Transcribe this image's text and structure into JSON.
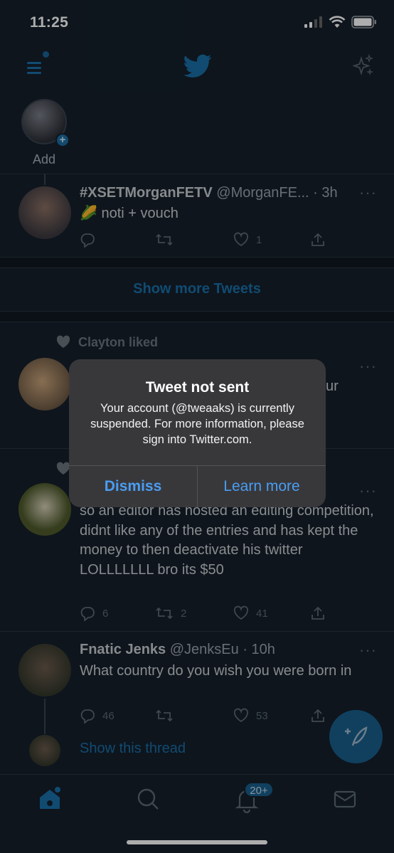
{
  "status_bar": {
    "time": "11:25"
  },
  "fleets": {
    "add_label": "Add"
  },
  "tweets": [
    {
      "name": "#XSETMorganFETV",
      "handle": "@MorganFE...",
      "time": "· 3h",
      "text": "🌽 noti + vouch",
      "replies": "",
      "retweets": "",
      "likes": "1"
    }
  ],
  "show_more": "Show more Tweets",
  "liked_tweet": {
    "liked_by": "Clayton liked",
    "partial_text": "ur"
  },
  "tweet2": {
    "text": "so an editor has hosted an editing competition, didnt like any of the entries and has kept the money to then deactivate his twitter LOLLLLLLL bro its $50",
    "replies": "6",
    "retweets": "2",
    "likes": "41"
  },
  "tweet3": {
    "name": "Fnatic Jenks",
    "handle": "@JenksEu",
    "time": "· 10h",
    "text": "What country do you wish you were born in",
    "replies": "46",
    "retweets": "",
    "likes": "53",
    "show_thread": "Show this thread"
  },
  "tabbar": {
    "notifications_badge": "20+"
  },
  "alert": {
    "title": "Tweet not sent",
    "message": "Your account (@tweaaks) is currently suspended. For more information, please sign into Twitter.com.",
    "dismiss": "Dismiss",
    "learn_more": "Learn more"
  },
  "colors": {
    "background": "#15202b",
    "accent": "#1d9bf0",
    "alert_button": "#4a9df2"
  }
}
